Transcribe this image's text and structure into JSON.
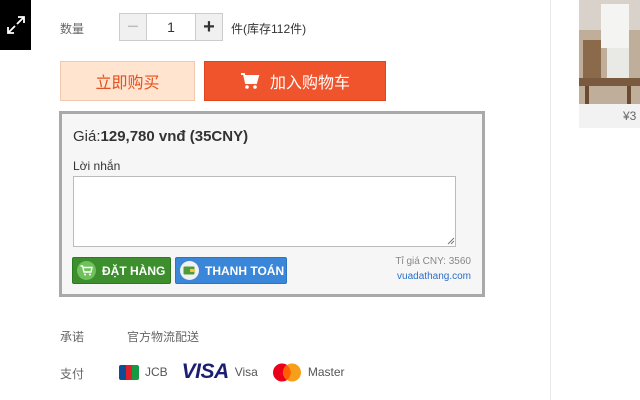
{
  "quantity": {
    "label": "数量",
    "value": "1",
    "minus": "−",
    "plus": "+",
    "stock_text": "件(库存112件)"
  },
  "actions": {
    "buy_now": "立即购买",
    "add_to_cart": "加入购物车"
  },
  "order_panel": {
    "price_prefix": "Giá:",
    "price_value": "129,780 vnđ (35CNY)",
    "message_label": "Lời nhắn",
    "message_value": "",
    "order_button": "ĐẶT HÀNG",
    "pay_button": "THANH TOÁN",
    "exchange_rate": "Tỉ giá CNY: 3560",
    "site_link": "vuadathang.com"
  },
  "service": {
    "promise_label": "承诺",
    "promise_value": "官方物流配送",
    "payment_label": "支付",
    "payment_methods": [
      "JCB",
      "Visa",
      "Master"
    ],
    "visa_logo": "VISA"
  },
  "side_product": {
    "price_text": "¥3"
  },
  "colors": {
    "accent_orange": "#f0542c",
    "buy_now_bg": "#ffe4d0",
    "order_green": "#3c8f2c",
    "pay_blue": "#3a86d8",
    "visa_navy": "#1a1f71"
  }
}
